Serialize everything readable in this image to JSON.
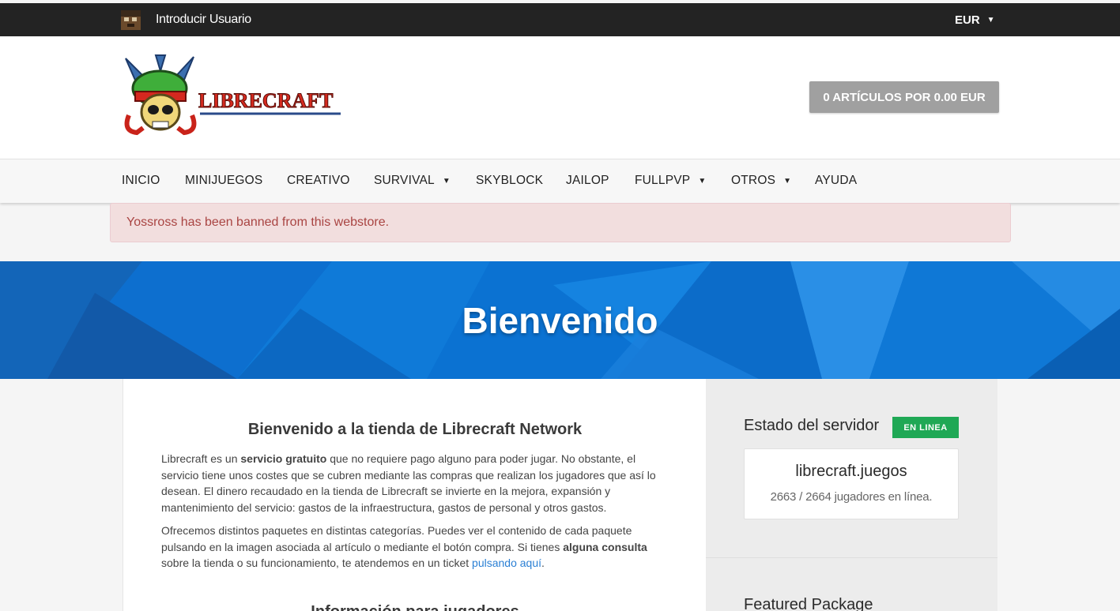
{
  "topbar": {
    "user_label": "Introducir Usuario",
    "currency": "EUR"
  },
  "header": {
    "logo_text": "LIBRECRAFT",
    "cart_label": "0 ARTÍCULOS POR 0.00 EUR"
  },
  "nav": {
    "items": [
      {
        "label": "INICIO",
        "dropdown": false
      },
      {
        "label": "MINIJUEGOS",
        "dropdown": false
      },
      {
        "label": "CREATIVO",
        "dropdown": false
      },
      {
        "label": "SURVIVAL",
        "dropdown": true
      },
      {
        "label": "SKYBLOCK",
        "dropdown": false
      },
      {
        "label": "JAILOP",
        "dropdown": false
      },
      {
        "label": "FULLPVP",
        "dropdown": true
      },
      {
        "label": "OTROS",
        "dropdown": true
      },
      {
        "label": "AYUDA",
        "dropdown": false
      }
    ]
  },
  "alert": {
    "message": "Yossross has been banned from this webstore."
  },
  "hero": {
    "title": "Bienvenido"
  },
  "main": {
    "heading": "Bienvenido a la tienda de Librecraft Network",
    "p1_a": "Librecraft es un ",
    "p1_bold": "servicio gratuito",
    "p1_b": " que no requiere pago alguno para poder jugar. No obstante, el servicio tiene unos costes que se cubren mediante las compras que realizan los jugadores que así lo desean. El dinero recaudado en la tienda de Librecraft se invierte en la mejora, expansión y mantenimiento del servicio: gastos de la infraestructura, gastos de personal y otros gastos.",
    "p2_a": "Ofrecemos distintos paquetes en distintas categorías. Puedes ver el contenido de cada paquete pulsando en la imagen asociada al artículo o mediante el botón compra. Si tienes ",
    "p2_bold": "alguna consulta",
    "p2_b": " sobre la tienda o su funcionamiento, te atendemos en un ticket ",
    "p2_link": "pulsando aquí",
    "p2_end": ".",
    "heading2": "Información para jugadores"
  },
  "sidebar": {
    "status_title": "Estado del servidor",
    "status_badge": "EN LINEA",
    "host": "librecraft.juegos",
    "players": "2663 / 2664 jugadores en línea.",
    "featured_title": "Featured Package"
  },
  "colors": {
    "topbar": "#232323",
    "hero_blue": "#0a74d6",
    "badge_green": "#1fa855",
    "alert_text": "#a94442",
    "cart_button": "#a0a0a0"
  },
  "icons": {
    "user": "player-head-icon",
    "currency_caret": "chevron-down-icon",
    "nav_caret": "chevron-down-icon"
  }
}
